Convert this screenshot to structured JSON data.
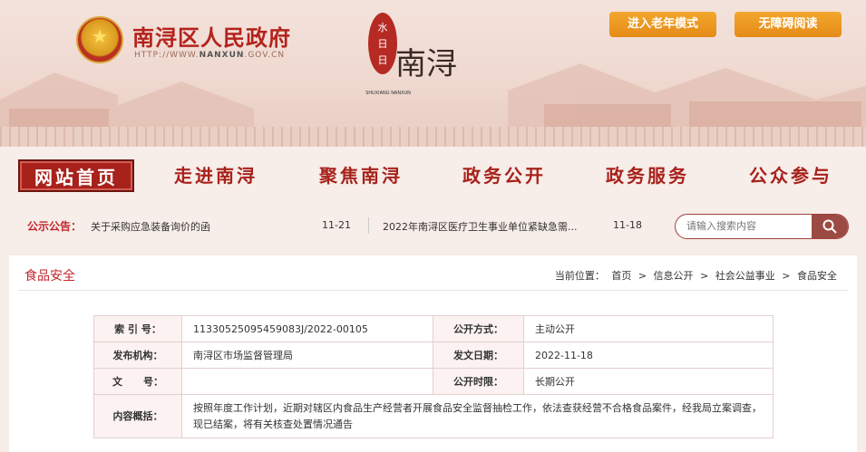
{
  "header": {
    "site_title": "南浔区人民政府",
    "site_url_prefix": "HTTP://WWW.",
    "site_url_domain": "NANXUN",
    "site_url_suffix": ".GOV.CN",
    "logo_brand_pinyin": "SHUXIANG NANXUN",
    "logo_brand_text": "南浔",
    "elder_mode_button": "进入老年模式",
    "accessible_button": "无障碍阅读"
  },
  "nav": {
    "items": [
      {
        "label": "网站首页",
        "active": true
      },
      {
        "label": "走进南浔"
      },
      {
        "label": "聚焦南浔"
      },
      {
        "label": "政务公开"
      },
      {
        "label": "政务服务"
      },
      {
        "label": "公众参与"
      }
    ]
  },
  "notice": {
    "label": "公示公告：",
    "items": [
      {
        "title": "关于采购应急装备询价的函",
        "date": "11-21"
      },
      {
        "title": "2022年南浔区医疗卫生事业单位紧缺急需...",
        "date": "11-18"
      }
    ]
  },
  "search": {
    "placeholder": "请输入搜索内容"
  },
  "panel": {
    "title": "食品安全",
    "breadcrumb": {
      "prefix": "当前位置：",
      "items": [
        "首页",
        "信息公开",
        "社会公益事业",
        "食品安全"
      ],
      "separator": ">"
    }
  },
  "meta": {
    "index_label": "索 引 号：",
    "index_value": "11330525095459083J/2022-00105",
    "disclosure_label": "公开方式：",
    "disclosure_value": "主动公开",
    "publisher_label": "发布机构：",
    "publisher_value": "南浔区市场监督管理局",
    "date_label": "发文日期：",
    "date_value": "2022-11-18",
    "docno_label": "文      号：",
    "docno_value": "",
    "period_label": "公开时限：",
    "period_value": "长期公开",
    "summary_label": "内容概括：",
    "summary_value": "按照年度工作计划，近期对辖区内食品生产经营者开展食品安全监督抽检工作，依法查获经营不合格食品案件，经我局立案调查，现已结案，将有关核查处置情况通告"
  },
  "colors": {
    "brand_red": "#c1272d",
    "nav_red": "#a8211b",
    "button_orange": "#e58b17"
  }
}
